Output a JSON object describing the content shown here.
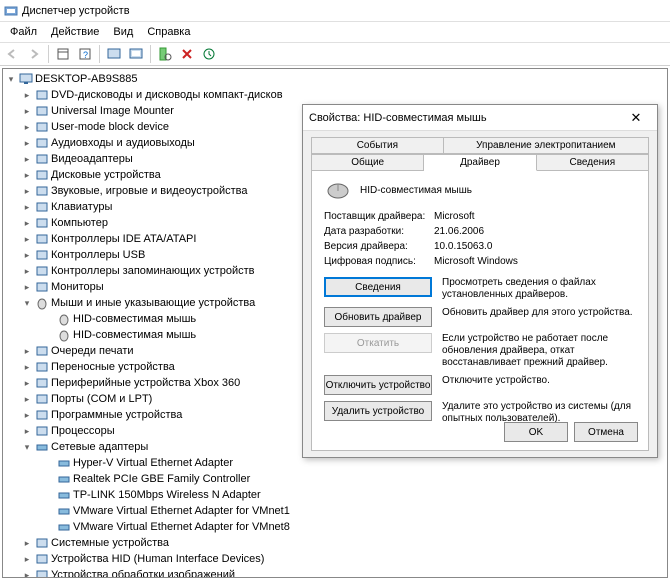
{
  "window": {
    "title": "Диспетчер устройств"
  },
  "menu": {
    "file": "Файл",
    "action": "Действие",
    "view": "Вид",
    "help": "Справка"
  },
  "tree": {
    "root": "DESKTOP-AB9S885",
    "nodes": [
      {
        "label": "DVD-дисководы и дисководы компакт-дисков",
        "icon": "disc"
      },
      {
        "label": "Universal Image Mounter",
        "icon": "generic"
      },
      {
        "label": "User-mode block device",
        "icon": "generic"
      },
      {
        "label": "Аудиовходы и аудиовыходы",
        "icon": "audio"
      },
      {
        "label": "Видеоадаптеры",
        "icon": "display"
      },
      {
        "label": "Дисковые устройства",
        "icon": "drive"
      },
      {
        "label": "Звуковые, игровые и видеоустройства",
        "icon": "audio"
      },
      {
        "label": "Клавиатуры",
        "icon": "keyboard"
      },
      {
        "label": "Компьютер",
        "icon": "computer"
      },
      {
        "label": "Контроллеры IDE ATA/ATAPI",
        "icon": "controller"
      },
      {
        "label": "Контроллеры USB",
        "icon": "usb"
      },
      {
        "label": "Контроллеры запоминающих устройств",
        "icon": "controller"
      },
      {
        "label": "Мониторы",
        "icon": "monitor"
      }
    ],
    "mice": {
      "label": "Мыши и иные указывающие устройства",
      "children": [
        {
          "label": "HID-совместимая мышь"
        },
        {
          "label": "HID-совместимая мышь"
        }
      ]
    },
    "after_mice": [
      {
        "label": "Очереди печати",
        "icon": "printer"
      },
      {
        "label": "Переносные устройства",
        "icon": "portable"
      },
      {
        "label": "Периферийные устройства Xbox 360",
        "icon": "xbox"
      },
      {
        "label": "Порты (COM и LPT)",
        "icon": "port"
      },
      {
        "label": "Программные устройства",
        "icon": "software"
      },
      {
        "label": "Процессоры",
        "icon": "cpu"
      }
    ],
    "network": {
      "label": "Сетевые адаптеры",
      "children": [
        {
          "label": "Hyper-V Virtual Ethernet Adapter"
        },
        {
          "label": "Realtek PCIe GBE Family Controller"
        },
        {
          "label": "TP-LINK 150Mbps Wireless N Adapter"
        },
        {
          "label": "VMware Virtual Ethernet Adapter for VMnet1"
        },
        {
          "label": "VMware Virtual Ethernet Adapter for VMnet8"
        }
      ]
    },
    "tail": [
      {
        "label": "Системные устройства",
        "icon": "system"
      },
      {
        "label": "Устройства HID (Human Interface Devices)",
        "icon": "hid"
      },
      {
        "label": "Устройства обработки изображений",
        "icon": "imaging"
      }
    ]
  },
  "dialog": {
    "title": "Свойства: HID-совместимая мышь",
    "tabs": {
      "events": "События",
      "power": "Управление электропитанием",
      "general": "Общие",
      "driver": "Драйвер",
      "details": "Сведения"
    },
    "device_name": "HID-совместимая мышь",
    "info": {
      "provider_label": "Поставщик драйвера:",
      "provider_value": "Microsoft",
      "date_label": "Дата разработки:",
      "date_value": "21.06.2006",
      "version_label": "Версия драйвера:",
      "version_value": "10.0.15063.0",
      "signer_label": "Цифровая подпись:",
      "signer_value": "Microsoft Windows"
    },
    "buttons": {
      "details": "Сведения",
      "details_desc": "Просмотреть сведения о файлах установленных драйверов.",
      "update": "Обновить драйвер",
      "update_desc": "Обновить драйвер для этого устройства.",
      "rollback": "Откатить",
      "rollback_desc": "Если устройство не работает после обновления драйвера, откат восстанавливает прежний драйвер.",
      "disable": "Отключить устройство",
      "disable_desc": "Отключите устройство.",
      "uninstall": "Удалить устройство",
      "uninstall_desc": "Удалите это устройство из системы (для опытных пользователей)."
    },
    "footer": {
      "ok": "OK",
      "cancel": "Отмена"
    }
  }
}
